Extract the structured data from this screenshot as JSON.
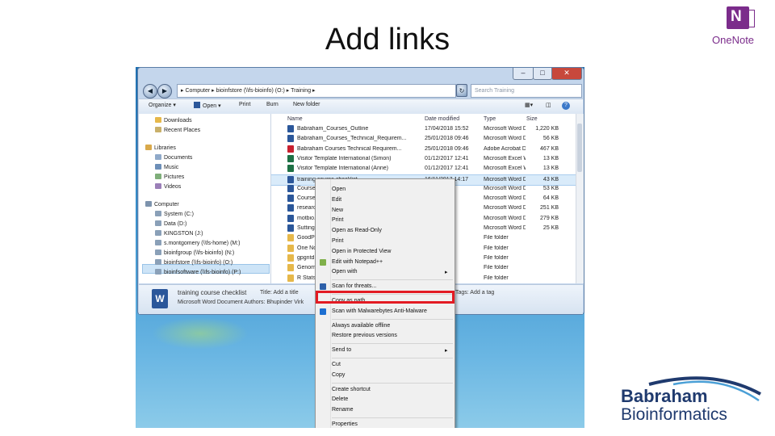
{
  "slide": {
    "title": "Add links",
    "onenote_label": "OneNote",
    "onenote_letter": "N",
    "logo_line1": "Babraham",
    "logo_line2": "Bioinformatics"
  },
  "explorer": {
    "window_buttons": [
      "–",
      "□",
      "✕"
    ],
    "address": "▸ Computer ▸ bioinfstore (\\\\fs-bioinfo) (O:) ▸ Training ▸",
    "search_placeholder": "Search Training",
    "toolbar": [
      "Organize ▾",
      "Open ▾",
      "Print",
      "Burn",
      "New folder"
    ],
    "nav_items": [
      {
        "label": "Downloads",
        "color": "#e6b84a"
      },
      {
        "label": "Recent Places",
        "color": "#c9b06a"
      },
      {
        "label": "Libraries",
        "color": "#d9a94b"
      },
      {
        "label": "Documents",
        "color": "#8fa9c9"
      },
      {
        "label": "Music",
        "color": "#6d8fb8"
      },
      {
        "label": "Pictures",
        "color": "#7fae7a"
      },
      {
        "label": "Videos",
        "color": "#9b7fb8"
      },
      {
        "label": "Computer",
        "color": "#7d93ad"
      },
      {
        "label": "System (C:)",
        "color": "#8aa0b8"
      },
      {
        "label": "Data (D:)",
        "color": "#8aa0b8"
      },
      {
        "label": "KINGSTON (J:)",
        "color": "#8aa0b8"
      },
      {
        "label": "s.montgomery (\\\\fs-home) (M:)",
        "color": "#8aa0b8"
      },
      {
        "label": "bioinfgroup (\\\\fs-bioinfo) (N:)",
        "color": "#8aa0b8"
      },
      {
        "label": "bioinfstore (\\\\fs-bioinfo) (O:)",
        "color": "#8aa0b8"
      },
      {
        "label": "bioinfsoftware (\\\\fs-bioinfo) (P:)",
        "color": "#8aa0b8"
      }
    ],
    "columns": [
      "Name",
      "Date modified",
      "Type",
      "Size"
    ],
    "files": [
      {
        "name": "Babraham_Courses_Outline",
        "date": "17/04/2018 15:52",
        "type": "Microsoft Word D...",
        "size": "1,220 KB",
        "color": "#2b579a"
      },
      {
        "name": "Babraham_Courses_Technical_Requirem...",
        "date": "25/01/2018 09:46",
        "type": "Microsoft Word D...",
        "size": "56 KB",
        "color": "#2b579a"
      },
      {
        "name": "Babraham Courses Technical Requirem...",
        "date": "25/01/2018 09:46",
        "type": "Adobe Acrobat D...",
        "size": "467 KB",
        "color": "#c8202f"
      },
      {
        "name": "Visitor Template International (Simon)",
        "date": "01/12/2017 12:41",
        "type": "Microsoft Excel W...",
        "size": "13 KB",
        "color": "#1e7145"
      },
      {
        "name": "Visitor Template International (Anne)",
        "date": "01/12/2017 12:41",
        "type": "Microsoft Excel W...",
        "size": "13 KB",
        "color": "#1e7145"
      },
      {
        "name": "training course checklist",
        "date": "16/11/2017 14:17",
        "type": "Microsoft Word D...",
        "size": "43 KB",
        "color": "#2b579a"
      },
      {
        "name": "Course ...",
        "date": "",
        "type": "Microsoft Word D...",
        "size": "53 KB",
        "color": "#2b579a"
      },
      {
        "name": "Course ...",
        "date": "",
        "type": "Microsoft Word D...",
        "size": "64 KB",
        "color": "#2b579a"
      },
      {
        "name": "research...",
        "date": "",
        "type": "Microsoft Word D...",
        "size": "251 KB",
        "color": "#2b579a"
      },
      {
        "name": "motbio...",
        "date": "",
        "type": "Microsoft Word D...",
        "size": "279 KB",
        "color": "#2b579a"
      },
      {
        "name": "Sutting ...",
        "date": "",
        "type": "Microsoft Word D...",
        "size": "25 KB",
        "color": "#2b579a"
      },
      {
        "name": "GoodPr...",
        "date": "",
        "type": "File folder",
        "size": "",
        "color": "#e6b84a"
      },
      {
        "name": "One Not...",
        "date": "",
        "type": "File folder",
        "size": "",
        "color": "#e6b84a"
      },
      {
        "name": "gpgntd",
        "date": "",
        "type": "File folder",
        "size": "",
        "color": "#e6b84a"
      },
      {
        "name": "Genomic...",
        "date": "",
        "type": "File folder",
        "size": "",
        "color": "#e6b84a"
      },
      {
        "name": "R Stats ...",
        "date": "",
        "type": "File folder",
        "size": "",
        "color": "#e6b84a"
      }
    ],
    "details": {
      "name": "training course checklist",
      "type_line": "Microsoft Word Document  Authors: Bhupinder Virk",
      "title_label": "Title: Add a title",
      "tags_label": "Tags: Add a tag",
      "icon_letter": "W"
    }
  },
  "context_menu": {
    "items": [
      {
        "label": "Open",
        "icon": "",
        "arrow": false,
        "sep_after": false
      },
      {
        "label": "Edit",
        "icon": "",
        "arrow": false,
        "sep_after": false
      },
      {
        "label": "New",
        "icon": "",
        "arrow": false,
        "sep_after": false
      },
      {
        "label": "Print",
        "icon": "",
        "arrow": false,
        "sep_after": false
      },
      {
        "label": "Open as Read-Only",
        "icon": "",
        "arrow": false,
        "sep_after": false
      },
      {
        "label": "Print",
        "icon": "",
        "arrow": false,
        "sep_after": false
      },
      {
        "label": "Open in Protected View",
        "icon": "",
        "arrow": false,
        "sep_after": false
      },
      {
        "label": "Edit with Notepad++",
        "icon": "notepad-icon",
        "arrow": false,
        "sep_after": false
      },
      {
        "label": "Open with",
        "icon": "",
        "arrow": true,
        "sep_after": true
      },
      {
        "label": "Scan for threats...",
        "icon": "shield-icon",
        "arrow": false,
        "sep_after": true
      },
      {
        "label": "Copy as path",
        "icon": "",
        "arrow": false,
        "sep_after": false
      },
      {
        "label": "Scan with Malwarebytes Anti-Malware",
        "icon": "malwarebytes-icon",
        "arrow": false,
        "sep_after": true
      },
      {
        "label": "Always available offline",
        "icon": "",
        "arrow": false,
        "sep_after": false
      },
      {
        "label": "Restore previous versions",
        "icon": "",
        "arrow": false,
        "sep_after": true
      },
      {
        "label": "Send to",
        "icon": "",
        "arrow": true,
        "sep_after": true
      },
      {
        "label": "Cut",
        "icon": "",
        "arrow": false,
        "sep_after": false
      },
      {
        "label": "Copy",
        "icon": "",
        "arrow": false,
        "sep_after": true
      },
      {
        "label": "Create shortcut",
        "icon": "",
        "arrow": false,
        "sep_after": false
      },
      {
        "label": "Delete",
        "icon": "",
        "arrow": false,
        "sep_after": false
      },
      {
        "label": "Rename",
        "icon": "",
        "arrow": false,
        "sep_after": true
      },
      {
        "label": "Properties",
        "icon": "",
        "arrow": false,
        "sep_after": false
      }
    ],
    "highlight_color": "#e31b23"
  },
  "colors": {
    "onenote": "#7b2c8b",
    "logo": "#1f3a6e"
  }
}
